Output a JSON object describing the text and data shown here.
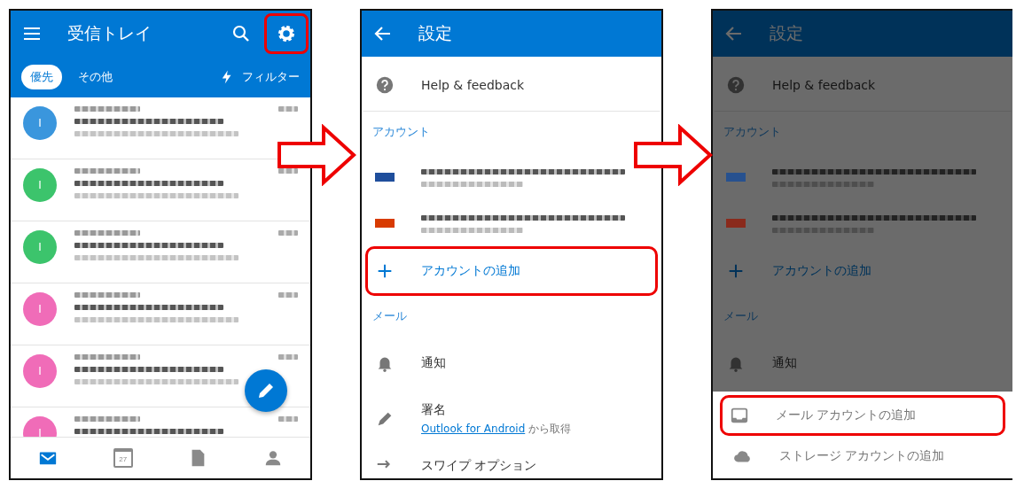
{
  "screens": [
    {
      "kind": "inbox",
      "title": "受信トレイ",
      "settings_highlighted": true,
      "tabs": [
        {
          "label": "優先",
          "selected": true
        },
        {
          "label": "その他",
          "selected": false
        }
      ],
      "filter": "フィルター",
      "messages": [
        {
          "initial": "I",
          "color": "#3a96dd"
        },
        {
          "initial": "I",
          "color": "#3cc46c"
        },
        {
          "initial": "I",
          "color": "#3cc46c"
        },
        {
          "initial": "I",
          "color": "#f06cb8"
        },
        {
          "initial": "I",
          "color": "#f06cb8"
        },
        {
          "initial": "I",
          "color": "#f06cb8"
        }
      ],
      "nav": [
        {
          "kind": "mail",
          "selected": true
        },
        {
          "kind": "calendar",
          "label": "27",
          "selected": false
        },
        {
          "kind": "files",
          "selected": false
        },
        {
          "kind": "people",
          "selected": false
        }
      ]
    },
    {
      "kind": "settings",
      "title": "設定",
      "dimmed": false,
      "items": [
        {
          "kind": "help",
          "label": "Help & feedback"
        },
        {
          "kind": "header",
          "label": "アカウント"
        },
        {
          "kind": "account",
          "color": "#1f4e9c"
        },
        {
          "kind": "account",
          "color": "#d83b01"
        },
        {
          "kind": "add",
          "label": "アカウントの追加",
          "highlighted": true
        },
        {
          "kind": "header",
          "label": "メール"
        },
        {
          "kind": "notify",
          "label": "通知"
        },
        {
          "kind": "signature",
          "label": "署名",
          "link": "Outlook for Android",
          "suffix": "から取得"
        },
        {
          "kind": "swipe",
          "label": "スワイプ オプション"
        }
      ]
    },
    {
      "kind": "settings",
      "title": "設定",
      "dimmed": true,
      "items": [
        {
          "kind": "help",
          "label": "Help & feedback"
        },
        {
          "kind": "header",
          "label": "アカウント"
        },
        {
          "kind": "account",
          "color": "#27518f"
        },
        {
          "kind": "account",
          "color": "#8a2a1c"
        },
        {
          "kind": "add",
          "label": "アカウントの追加",
          "highlighted": false
        },
        {
          "kind": "header",
          "label": "メール"
        },
        {
          "kind": "notify",
          "label": "通知"
        }
      ],
      "sheet": [
        {
          "kind": "mail",
          "label": "メール アカウントの追加",
          "highlighted": true
        },
        {
          "kind": "storage",
          "label": "ストレージ アカウントの追加",
          "highlighted": false
        }
      ]
    }
  ]
}
